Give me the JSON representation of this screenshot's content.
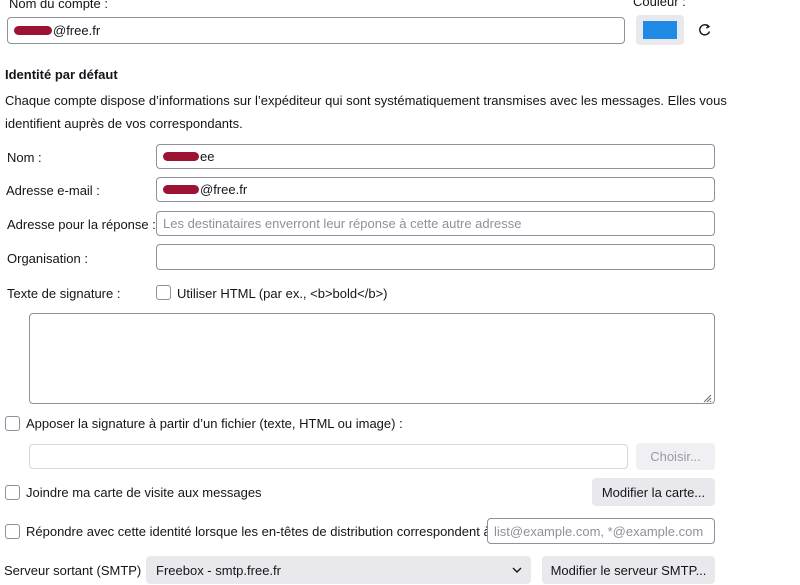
{
  "account": {
    "name_label": "Nom du compte :",
    "name_value": "@free.fr",
    "color_label": "Couleur :",
    "color_value": "#1f8be6",
    "reset_icon": "refresh-icon"
  },
  "identity": {
    "heading": "Identité par défaut",
    "description_line1": "Chaque compte dispose d’informations sur l’expéditeur qui sont systématiquement transmises avec les messages. Elles vous",
    "description_line2": "identifient auprès de vos correspondants.",
    "name_label": "Nom :",
    "name_value": "ee",
    "email_label": "Adresse e-mail :",
    "email_value": "@free.fr",
    "reply_label": "Adresse pour la réponse :",
    "reply_placeholder": "Les destinataires enverront leur réponse à cette autre adresse",
    "org_label": "Organisation :",
    "org_value": "",
    "signature_label": "Texte de signature :",
    "use_html_label": "Utiliser HTML (par ex., <b>bold</b>)",
    "signature_text": ""
  },
  "signature_file": {
    "checkbox_label": "Apposer la signature à partir d’un fichier (texte, HTML ou image) :",
    "path_value": "",
    "choose_button": "Choisir..."
  },
  "vcard": {
    "checkbox_label": "Joindre ma carte de visite aux messages",
    "edit_button": "Modifier la carte..."
  },
  "reply_identity": {
    "checkbox_label": "Répondre avec cette identité lorsque les en-têtes de distribution correspondent à :",
    "placeholder": "list@example.com, *@example.com"
  },
  "smtp": {
    "label": "Serveur sortant (SMTP) :",
    "selected": "Freebox - smtp.free.fr",
    "edit_button": "Modifier le serveur SMTP..."
  }
}
